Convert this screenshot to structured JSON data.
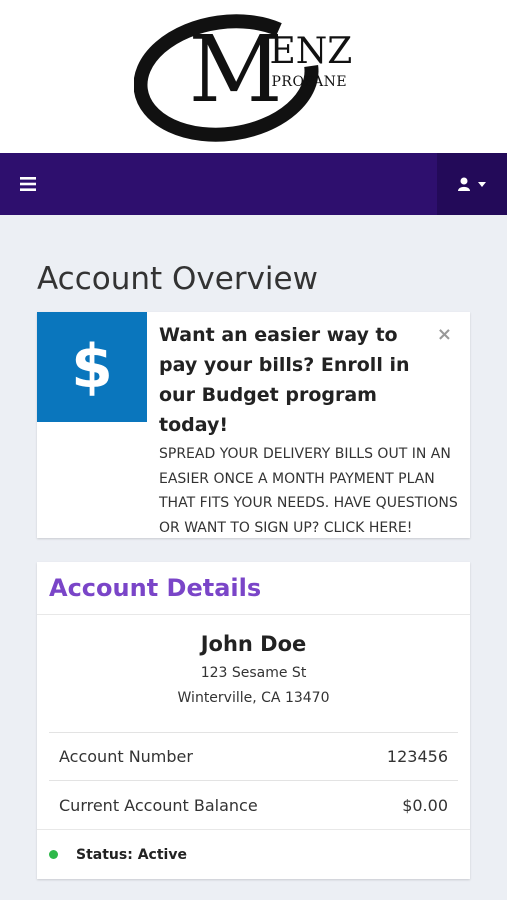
{
  "brand": {
    "logo_letter": "M",
    "logo_word": "ENZ",
    "logo_sub": "PROPANE"
  },
  "navbar": {
    "menu_icon": "hamburger-icon",
    "user_icon": "user-icon",
    "background": "#2e0f6e"
  },
  "page": {
    "title": "Account Overview"
  },
  "promo": {
    "icon_glyph": "$",
    "headline": "Want an easier way to pay your bills? Enroll in our Budget program today!",
    "text": "SPREAD YOUR DELIVERY BILLS OUT IN AN EASIER ONCE A MONTH PAYMENT PLAN THAT FITS YOUR NEEDS. HAVE QUESTIONS OR WANT TO SIGN UP? CLICK HERE!",
    "close_glyph": "×",
    "icon_color": "#0a76bd"
  },
  "account": {
    "header": "Account Details",
    "name": "John Doe",
    "address_line1": "123 Sesame St",
    "address_line2": "Winterville, CA 13470",
    "rows": [
      {
        "label": "Account Number",
        "value": "123456"
      },
      {
        "label": "Current Account Balance",
        "value": "$0.00"
      }
    ],
    "status": "Status: Active",
    "status_color": "#2eb84a",
    "header_color": "#7a45c8"
  }
}
